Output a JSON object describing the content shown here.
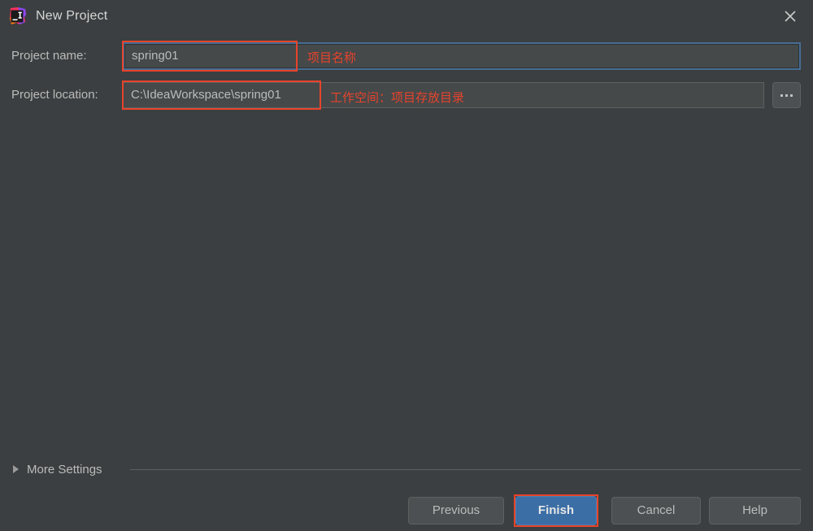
{
  "window": {
    "title": "New Project",
    "logo_icon": "intellij-idea-logo",
    "close_icon": "close-icon"
  },
  "form": {
    "project_name": {
      "label": "Project name:",
      "value": "spring01",
      "placeholder": "",
      "annotation": "项目名称"
    },
    "project_location": {
      "label": "Project location:",
      "value": "C:\\IdeaWorkspace\\spring01",
      "placeholder": "",
      "annotation": "工作空间：项目存放目录",
      "browse_label": "..."
    }
  },
  "more_settings": {
    "label": "More Settings",
    "expanded": false,
    "arrow_icon": "chevron-right-icon"
  },
  "footer": {
    "previous_label": "Previous",
    "finish_label": "Finish",
    "cancel_label": "Cancel",
    "help_label": "Help"
  },
  "colors": {
    "background": "#3c3f41",
    "field_background": "#45494a",
    "text": "#bbbbbb",
    "focus_border": "#466d94",
    "annotation_red": "#e8432b",
    "primary_button": "#3b6ea5"
  }
}
